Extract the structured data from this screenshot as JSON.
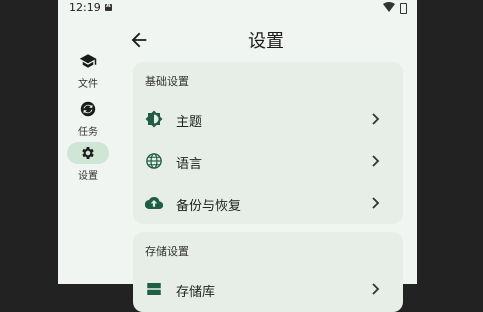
{
  "status": {
    "time": "12:19"
  },
  "rail": {
    "items": [
      {
        "label": "文件",
        "icon": "school-icon",
        "active": false
      },
      {
        "label": "任务",
        "icon": "sync-task-icon",
        "active": false
      },
      {
        "label": "设置",
        "icon": "gear-icon",
        "active": true
      }
    ]
  },
  "header": {
    "title": "设置"
  },
  "sections": [
    {
      "title": "基础设置",
      "items": [
        {
          "label": "主题",
          "icon": "theme-brightness-icon"
        },
        {
          "label": "语言",
          "icon": "globe-icon"
        },
        {
          "label": "备份与恢复",
          "icon": "cloud-upload-icon"
        }
      ]
    },
    {
      "title": "存储设置",
      "items": [
        {
          "label": "存储库",
          "icon": "storage-icon"
        }
      ]
    }
  ],
  "colors": {
    "accent": "#1f5e45",
    "active_pill": "#cfe5d6",
    "background": "#f1f5f1",
    "card": "#e7ede7"
  }
}
